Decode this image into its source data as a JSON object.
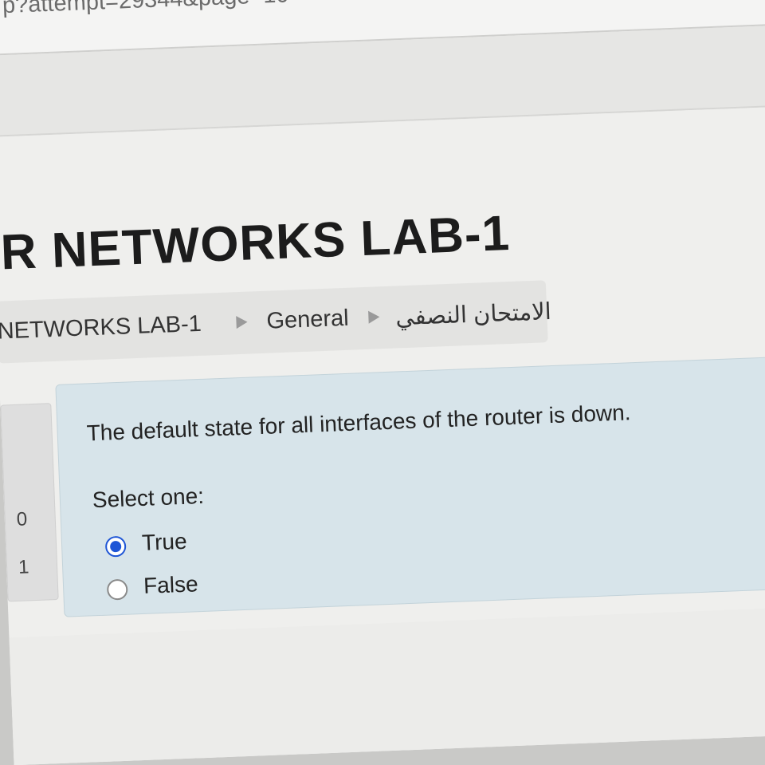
{
  "browser": {
    "url_fragment": "p?attempt=29344&page=10"
  },
  "course": {
    "title": "R NETWORKS LAB-1"
  },
  "breadcrumb": {
    "items": [
      {
        "label": "NETWORKS LAB-1"
      },
      {
        "label": "General"
      },
      {
        "label": "الامتحان النصفي"
      }
    ]
  },
  "info": {
    "marks": [
      "0",
      "1"
    ]
  },
  "question": {
    "text": "The default state for all interfaces of the router  is down.",
    "prompt": "Select one:",
    "options": [
      {
        "label": "True",
        "selected": true
      },
      {
        "label": "False",
        "selected": false
      }
    ]
  },
  "colors": {
    "question_panel": "#d7e4ea",
    "radio_selected": "#1e55d6"
  }
}
